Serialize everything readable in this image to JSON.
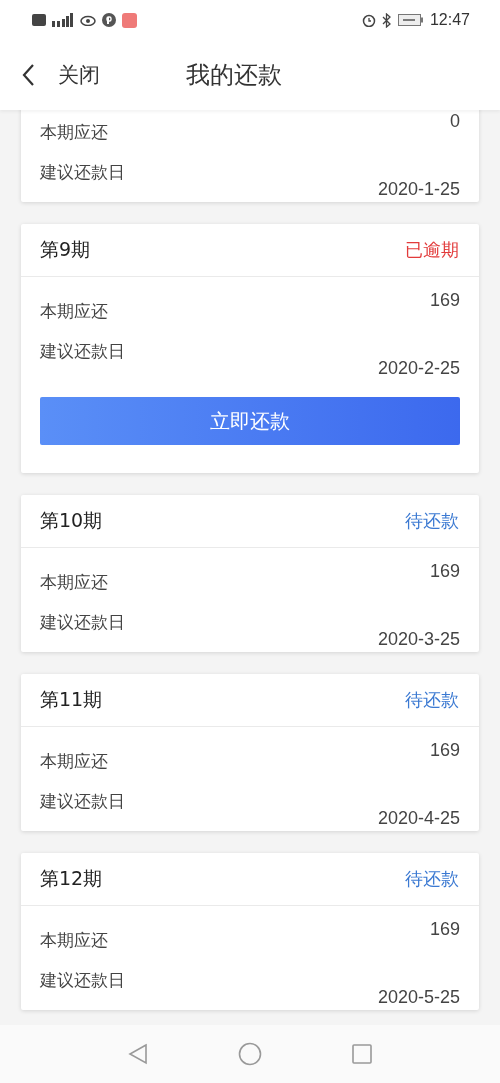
{
  "status_bar": {
    "time": "12:47"
  },
  "header": {
    "back_label": "关闭",
    "title": "我的还款"
  },
  "partial_card": {
    "rows": [
      {
        "label": "本期应还",
        "value": "0"
      },
      {
        "label": "建议还款日",
        "value": "2020-1-25"
      }
    ]
  },
  "installments": [
    {
      "period": "第9期",
      "status": "已逾期",
      "kind": "overdue",
      "rows": [
        {
          "label": "本期应还",
          "value": "169"
        },
        {
          "label": "建议还款日",
          "value": "2020-2-25"
        }
      ],
      "button": "立即还款"
    },
    {
      "period": "第10期",
      "status": "待还款",
      "kind": "pending",
      "rows": [
        {
          "label": "本期应还",
          "value": "169"
        },
        {
          "label": "建议还款日",
          "value": "2020-3-25"
        }
      ]
    },
    {
      "period": "第11期",
      "status": "待还款",
      "kind": "pending",
      "rows": [
        {
          "label": "本期应还",
          "value": "169"
        },
        {
          "label": "建议还款日",
          "value": "2020-4-25"
        }
      ]
    },
    {
      "period": "第12期",
      "status": "待还款",
      "kind": "pending",
      "rows": [
        {
          "label": "本期应还",
          "value": "169"
        },
        {
          "label": "建议还款日",
          "value": "2020-5-25"
        }
      ]
    }
  ]
}
